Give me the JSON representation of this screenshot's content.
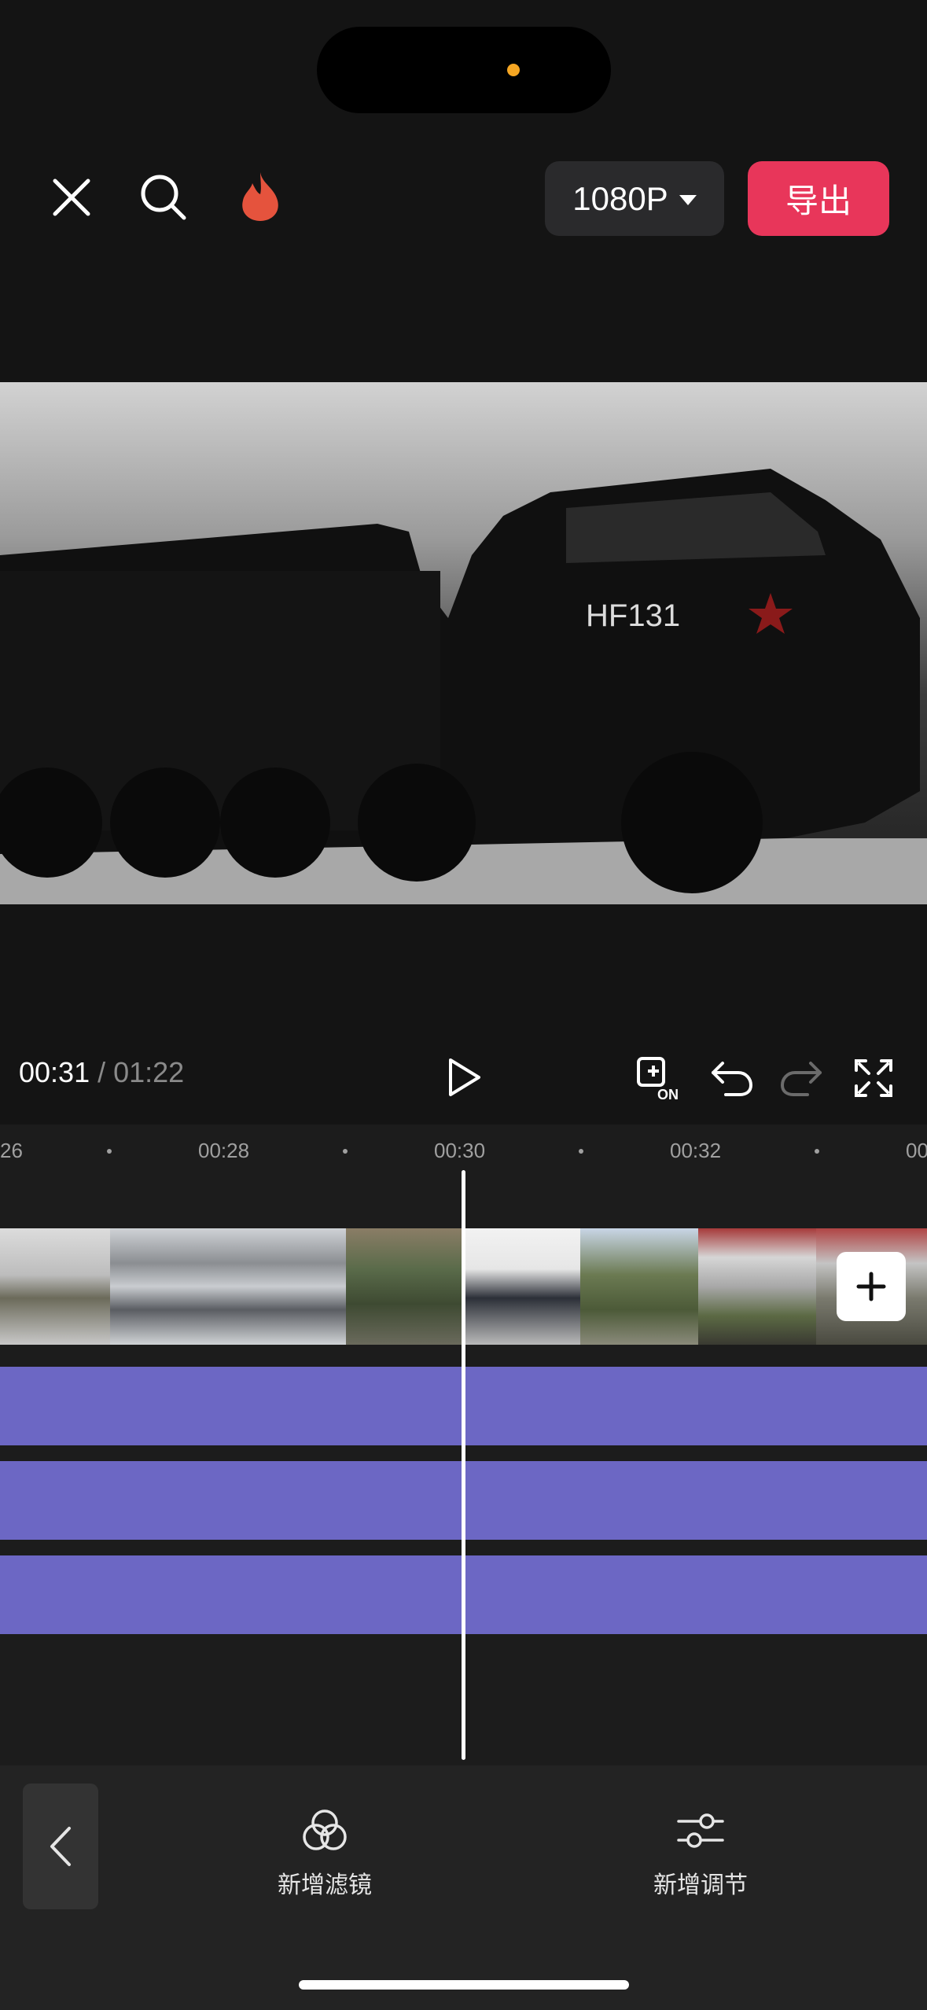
{
  "top_bar": {
    "resolution_label": "1080P",
    "export_label": "导出"
  },
  "preview": {
    "vehicle_plate": "HF131"
  },
  "playback": {
    "current_time": "00:31",
    "separator": "/",
    "total_time": "01:22"
  },
  "ruler": {
    "ticks": [
      "26",
      "00:28",
      "00:30",
      "00:32",
      "00"
    ]
  },
  "bottom_toolbar": {
    "items": [
      {
        "label": "新增滤镜",
        "icon": "filter-icon"
      },
      {
        "label": "新增调节",
        "icon": "adjust-sliders-icon"
      }
    ]
  },
  "colors": {
    "export": "#e8365a",
    "track": "#6c67c4",
    "flame": "#e5533d"
  }
}
